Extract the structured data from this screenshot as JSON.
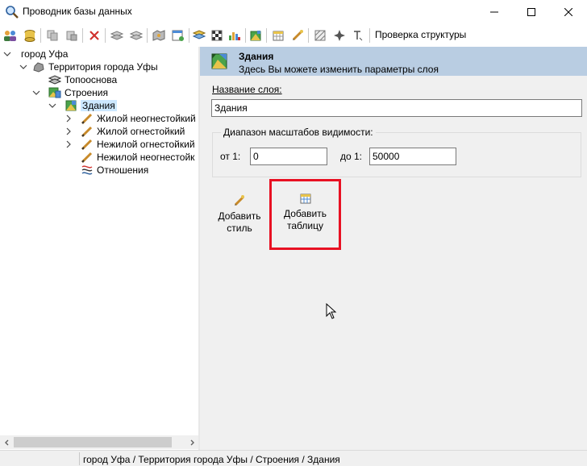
{
  "window": {
    "title": "Проводник базы данных"
  },
  "toolbar": {
    "check_structure_label": "Проверка структуры"
  },
  "tree": {
    "root": "город Уфа",
    "territory": "Территория города Уфы",
    "toposnova": "Топооснова",
    "stroenia": "Строения",
    "zdaniya": "Здания",
    "children": [
      "Жилой неогнестойкий",
      "Жилой огнестойкий",
      "Нежилой огнестойкий",
      "Нежилой неогнестойк",
      "Отношения"
    ]
  },
  "header": {
    "title": "Здания",
    "subtitle": "Здесь Вы можете изменить параметры слоя"
  },
  "form": {
    "layer_name_label": "Название слоя:",
    "layer_name_value": "Здания",
    "scale_group_title": "Диапазон масштабов видимости:",
    "from_label": "от 1:",
    "from_value": "0",
    "to_label": "до 1:",
    "to_value": "50000"
  },
  "actions": {
    "add_style_line1": "Добавить",
    "add_style_line2": "стиль",
    "add_table_line1": "Добавить",
    "add_table_line2": "таблицу"
  },
  "statusbar": {
    "path": "город Уфа / Территория города Уфы / Строения / Здания"
  },
  "colors": {
    "header_bg": "#b9cde2",
    "selection": "#cce8ff",
    "highlight_border": "#e81123",
    "pane_bg": "#f0f0f0"
  }
}
